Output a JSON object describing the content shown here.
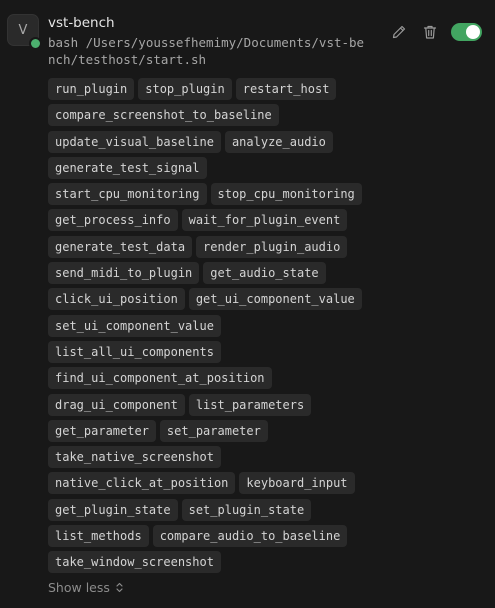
{
  "server": {
    "avatar_letter": "V",
    "name": "vst-bench",
    "command": "bash /Users/youssefhemimy/Documents/vst-bench/testhost/start.sh",
    "enabled": true,
    "status_color": "#4caf6e"
  },
  "icons": {
    "edit": "pencil-icon",
    "delete": "trash-icon",
    "expand": "chevron-up-down-icon"
  },
  "tools": [
    "run_plugin",
    "stop_plugin",
    "restart_host",
    "compare_screenshot_to_baseline",
    "update_visual_baseline",
    "analyze_audio",
    "generate_test_signal",
    "start_cpu_monitoring",
    "stop_cpu_monitoring",
    "get_process_info",
    "wait_for_plugin_event",
    "generate_test_data",
    "render_plugin_audio",
    "send_midi_to_plugin",
    "get_audio_state",
    "click_ui_position",
    "get_ui_component_value",
    "set_ui_component_value",
    "list_all_ui_components",
    "find_ui_component_at_position",
    "drag_ui_component",
    "list_parameters",
    "get_parameter",
    "set_parameter",
    "take_native_screenshot",
    "native_click_at_position",
    "keyboard_input",
    "get_plugin_state",
    "set_plugin_state",
    "list_methods",
    "compare_audio_to_baseline",
    "take_window_screenshot"
  ],
  "footer": {
    "show_less_label": "Show less"
  },
  "colors": {
    "background": "#181818",
    "chip_bg": "#2a2a2a",
    "toggle_on": "#42a561"
  }
}
